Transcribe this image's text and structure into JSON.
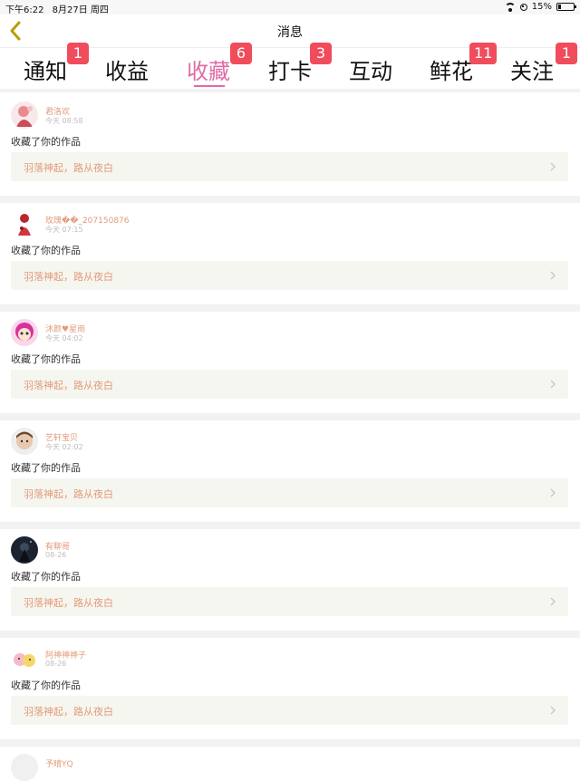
{
  "status": {
    "time": "下午6:22",
    "date": "8月27日 周四",
    "battery": "15%"
  },
  "nav": {
    "title": "消息"
  },
  "tabs": [
    {
      "label": "通知",
      "badge": "1"
    },
    {
      "label": "收益",
      "badge": ""
    },
    {
      "label": "收藏",
      "badge": "6"
    },
    {
      "label": "打卡",
      "badge": "3"
    },
    {
      "label": "互动",
      "badge": ""
    },
    {
      "label": "鲜花",
      "badge": "11"
    },
    {
      "label": "关注",
      "badge": "1"
    }
  ],
  "active_tab": "收藏",
  "colors": {
    "accent": "#e06aa5",
    "badge": "#f04c5c",
    "username": "#e29b7b",
    "card_bg": "#f6f6f0"
  },
  "items": [
    {
      "user": "君洛欢",
      "time": "今天 08:58",
      "action": "收藏了你的作品",
      "work": "羽落神起，路从夜白"
    },
    {
      "user": "玫瑰��_207150876",
      "time": "今天 07:15",
      "action": "收藏了你的作品",
      "work": "羽落神起，路从夜白"
    },
    {
      "user": "沐颜♥星雨",
      "time": "今天 04:02",
      "action": "收藏了你的作品",
      "work": "羽落神起，路从夜白"
    },
    {
      "user": "艺轩宝贝",
      "time": "今天 02:02",
      "action": "收藏了你的作品",
      "work": "羽落神起，路从夜白"
    },
    {
      "user": "有聊哥",
      "time": "08-26",
      "action": "收藏了你的作品",
      "work": "羽落神起，路从夜白"
    },
    {
      "user": "阿神神神子",
      "time": "08-26",
      "action": "收藏了你的作品",
      "work": "羽落神起，路从夜白"
    },
    {
      "user": "予晴YQ",
      "time": "",
      "action": "",
      "work": ""
    }
  ]
}
